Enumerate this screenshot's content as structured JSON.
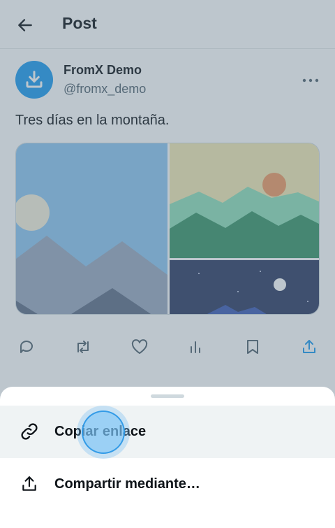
{
  "header": {
    "title": "Post",
    "back_icon": "arrow-left-icon"
  },
  "post": {
    "display_name": "FromX Demo",
    "handle": "@fromx_demo",
    "text": "Tres días en la montaña.",
    "avatar_icon": "download-icon",
    "avatar_color": "#1d9bf0",
    "more_icon": "more-horizontal-icon",
    "media": [
      {
        "name": "day-mountains-photo"
      },
      {
        "name": "sunset-hills-photo"
      },
      {
        "name": "night-sky-photo"
      }
    ]
  },
  "actions": [
    {
      "icon": "reply-icon"
    },
    {
      "icon": "repost-icon"
    },
    {
      "icon": "like-icon"
    },
    {
      "icon": "views-icon"
    },
    {
      "icon": "bookmark-icon"
    },
    {
      "icon": "share-icon",
      "color": "#1d9bf0"
    }
  ],
  "share_sheet": {
    "items": [
      {
        "label": "Copiar enlace",
        "icon": "link-icon",
        "highlighted": true
      },
      {
        "label": "Compartir mediante…",
        "icon": "share-icon"
      }
    ]
  },
  "colors": {
    "accent": "#1d9bf0",
    "text_primary": "#0f1419",
    "text_secondary": "#536471",
    "overlay": "rgba(91,112,131,0.40)"
  }
}
